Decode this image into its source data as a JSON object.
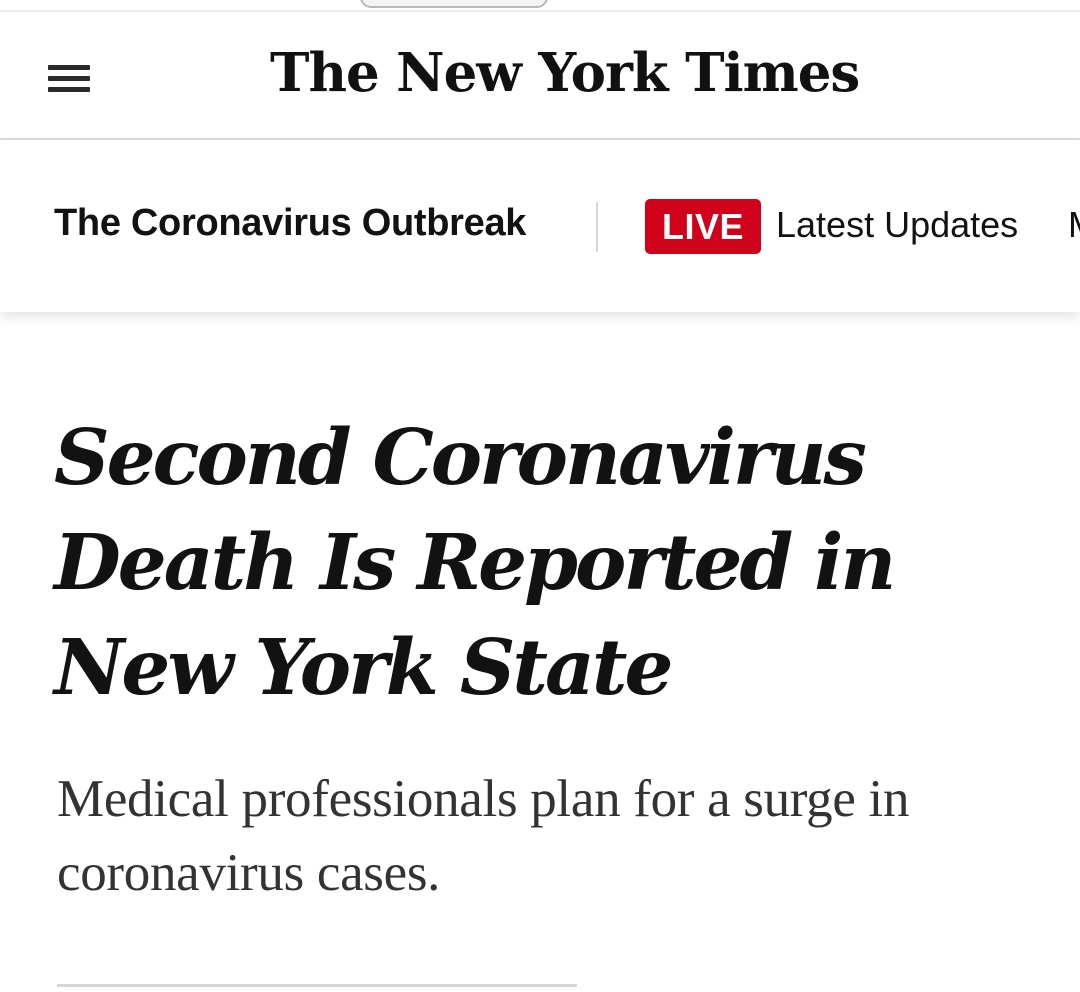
{
  "masthead": {
    "logo_text": "The New York Times",
    "menu_icon": "hamburger-menu-icon"
  },
  "subnav": {
    "section_title": "The Coronavirus Outbreak",
    "live_badge": "LIVE",
    "latest_updates": "Latest Updates",
    "overflow_text": "M"
  },
  "article": {
    "headline": "Second Coronavirus Death Is Reported in New York State",
    "summary": "Medical professionals plan for a surge in coronavirus cases."
  },
  "colors": {
    "live_badge_bg": "#d0021b",
    "text": "#121212",
    "summary_text": "#333333"
  }
}
